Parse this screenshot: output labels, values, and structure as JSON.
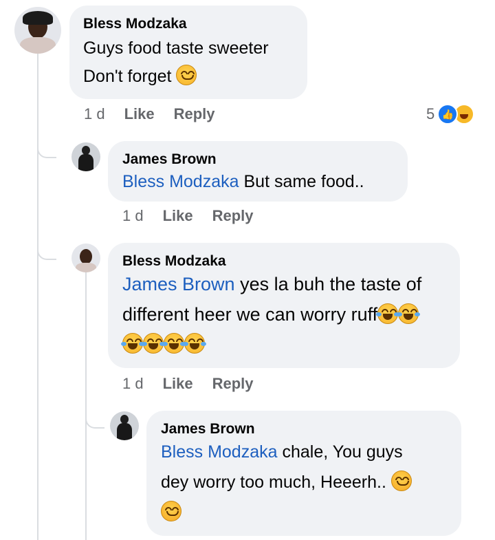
{
  "comments": [
    {
      "author": "Bless Modzaka",
      "text_line1": "Guys food taste sweeter",
      "text_line2": "Don't forget",
      "time": "1 d",
      "like": "Like",
      "reply": "Reply",
      "reaction_count": "5",
      "reactions": [
        "like-icon",
        "haha-icon"
      ]
    },
    {
      "author": "James Brown",
      "mention": "Bless Modzaka",
      "text": "But same food..",
      "time": "1 d",
      "like": "Like",
      "reply": "Reply"
    },
    {
      "author": "Bless Modzaka",
      "mention": "James Brown",
      "text_line1": "yes la buh the taste of",
      "text_line2": "different heer we can worry ruff",
      "time": "1 d",
      "like": "Like",
      "reply": "Reply"
    },
    {
      "author": "James Brown",
      "mention": "Bless Modzaka",
      "text_line1": "chale, You guys",
      "text_line2": "dey worry too much, Heeerh..",
      "emoji": "smiling-face-icon"
    }
  ],
  "colors": {
    "bubble": "#f0f2f5",
    "mention": "#1d5fbf",
    "meta": "#65676b",
    "like_blue": "#1877f2"
  }
}
